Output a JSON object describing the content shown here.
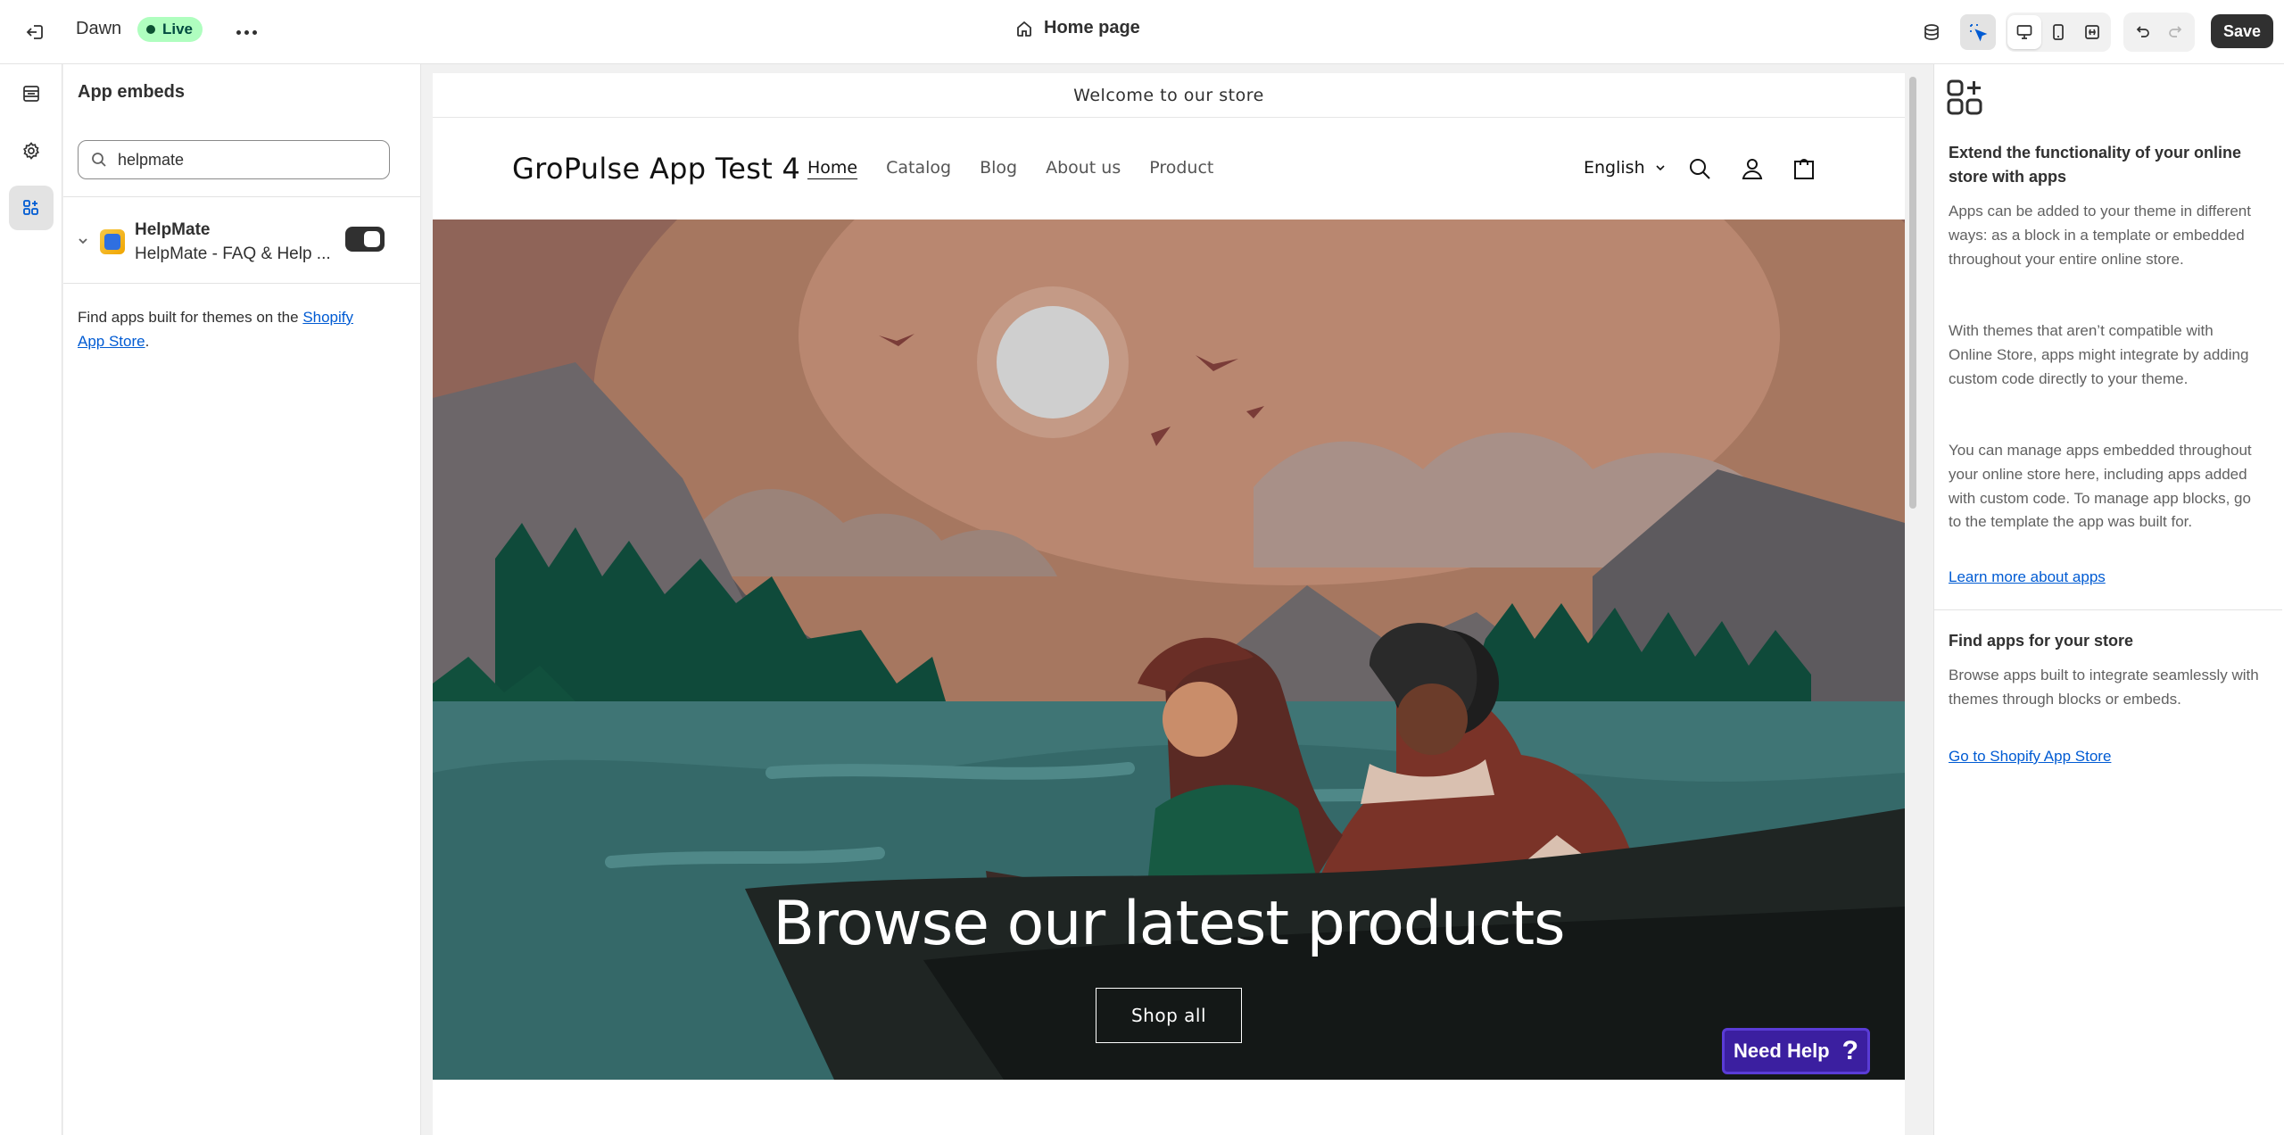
{
  "topbar": {
    "theme_name": "Dawn",
    "status_badge": "Live",
    "page_selector": "Home page",
    "save_label": "Save"
  },
  "sidebar": {
    "title": "App embeds",
    "search": {
      "value": "helpmate",
      "placeholder": ""
    },
    "apps": [
      {
        "name": "HelpMate",
        "subtitle": "HelpMate - FAQ & Help ...",
        "enabled": true
      }
    ],
    "find_text": "Find apps built for themes on the ",
    "find_link": "Shopify App Store",
    "find_end": "."
  },
  "preview": {
    "announcement": "Welcome to our store",
    "store_name": "GroPulse App Test 4",
    "nav": [
      "Home",
      "Catalog",
      "Blog",
      "About us",
      "Product"
    ],
    "language": "English",
    "hero_title": "Browse our latest products",
    "hero_button": "Shop all",
    "help_widget": "Need Help",
    "help_widget_icon": "?"
  },
  "right_panel": {
    "heading1": "Extend the functionality of your online store with apps",
    "para1": "Apps can be added to your theme in different ways: as a block in a template or embedded throughout your entire online store.",
    "para2": "With themes that aren’t compatible with Online Store, apps might integrate by adding custom code directly to your theme.",
    "para3": "You can manage apps embedded throughout your online store here, including apps added with custom code. To manage app blocks, go to the template the app was built for.",
    "link1": "Learn more about apps",
    "heading2": "Find apps for your store",
    "para4": "Browse apps built to integrate seamlessly with themes through blocks or embeds.",
    "link2": "Go to Shopify App Store"
  },
  "colors": {
    "live_badge_bg": "#affebf",
    "save_button_bg": "#303030",
    "link": "#005bd3",
    "help_widget_bg": "#3b1fa0"
  }
}
